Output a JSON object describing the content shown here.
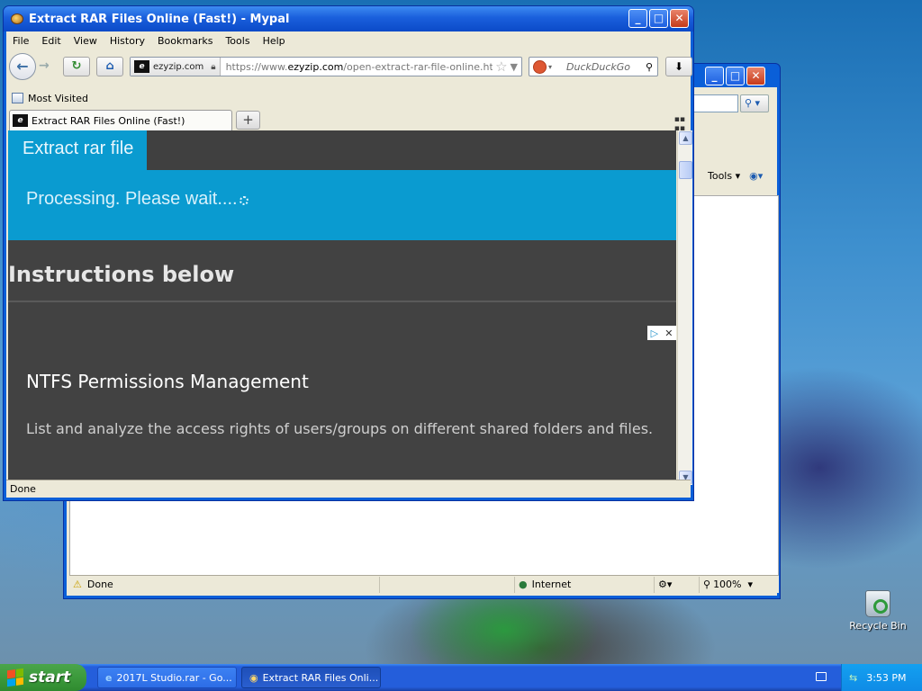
{
  "ie_window": {
    "tools_label": "Tools",
    "status": {
      "done": "Done",
      "zone": "Internet",
      "zoom": "100%"
    }
  },
  "firefox": {
    "title": "Extract RAR Files Online (Fast!) - Mypal",
    "menu": [
      "File",
      "Edit",
      "View",
      "History",
      "Bookmarks",
      "Tools",
      "Help"
    ],
    "identity_label": "ezyzip.com",
    "url_prefix": "https://www.",
    "url_domain": "ezyzip.com",
    "url_path": "/open-extract-rar-file-online.html",
    "search_placeholder": "DuckDuckGo",
    "bookmark_most_visited": "Most Visited",
    "tab_title": "Extract RAR Files Online (Fast!)",
    "status": "Done"
  },
  "page": {
    "brand_tab": "Extract rar file",
    "processing": "Processing. Please wait....",
    "instructions_heading": "Instructions below",
    "ad_title": "NTFS Permissions Management",
    "ad_description": "List and analyze the access rights of users/groups on different shared folders and files."
  },
  "desktop": {
    "recycle_bin": "Recycle Bin"
  },
  "taskbar": {
    "start": "start",
    "tasks": [
      "2017L Studio.rar - Go...",
      "Extract RAR Files Onli..."
    ],
    "clock": "3:53 PM"
  },
  "colors": {
    "site_blue": "#0a9bd0",
    "site_dark": "#424242",
    "xp_title": "#0a5fd8"
  }
}
